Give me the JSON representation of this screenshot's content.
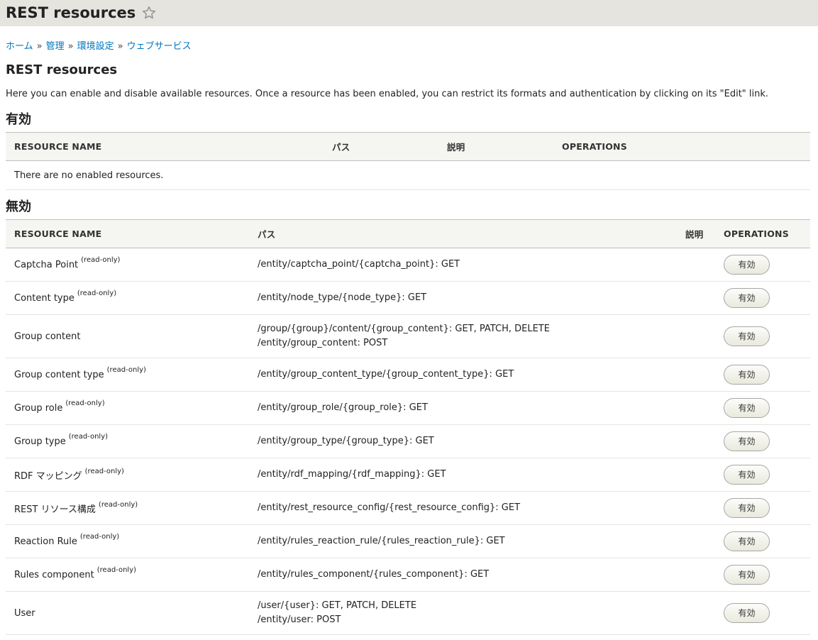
{
  "page_title": "REST resources",
  "breadcrumb": [
    "ホーム",
    "管理",
    "環境設定",
    "ウェブサービス"
  ],
  "heading": "REST resources",
  "description": "Here you can enable and disable available resources. Once a resource has been enabled, you can restrict its formats and authentication by clicking on its \"Edit\" link.",
  "enabled": {
    "title": "有効",
    "columns": [
      "RESOURCE NAME",
      "パス",
      "説明",
      "OPERATIONS"
    ],
    "empty_text": "There are no enabled resources."
  },
  "disabled": {
    "title": "無効",
    "columns": [
      "RESOURCE NAME",
      "パス",
      "説明",
      "OPERATIONS"
    ],
    "read_only_label": "(read-only)",
    "button_label": "有効",
    "rows": [
      {
        "name": "Captcha Point",
        "read_only": true,
        "paths": [
          "/entity/captcha_point/{captcha_point}: GET"
        ]
      },
      {
        "name": "Content type",
        "read_only": true,
        "paths": [
          "/entity/node_type/{node_type}: GET"
        ]
      },
      {
        "name": "Group content",
        "read_only": false,
        "paths": [
          "/group/{group}/content/{group_content}: GET, PATCH, DELETE",
          "/entity/group_content: POST"
        ]
      },
      {
        "name": "Group content type",
        "read_only": true,
        "paths": [
          "/entity/group_content_type/{group_content_type}: GET"
        ]
      },
      {
        "name": "Group role",
        "read_only": true,
        "paths": [
          "/entity/group_role/{group_role}: GET"
        ]
      },
      {
        "name": "Group type",
        "read_only": true,
        "paths": [
          "/entity/group_type/{group_type}: GET"
        ]
      },
      {
        "name": "RDF マッピング",
        "read_only": true,
        "paths": [
          "/entity/rdf_mapping/{rdf_mapping}: GET"
        ]
      },
      {
        "name": "REST リソース構成",
        "read_only": true,
        "paths": [
          "/entity/rest_resource_config/{rest_resource_config}: GET"
        ]
      },
      {
        "name": "Reaction Rule",
        "read_only": true,
        "paths": [
          "/entity/rules_reaction_rule/{rules_reaction_rule}: GET"
        ]
      },
      {
        "name": "Rules component",
        "read_only": true,
        "paths": [
          "/entity/rules_component/{rules_component}: GET"
        ]
      },
      {
        "name": "User",
        "read_only": false,
        "paths": [
          "/user/{user}: GET, PATCH, DELETE",
          "/entity/user: POST"
        ]
      }
    ]
  }
}
